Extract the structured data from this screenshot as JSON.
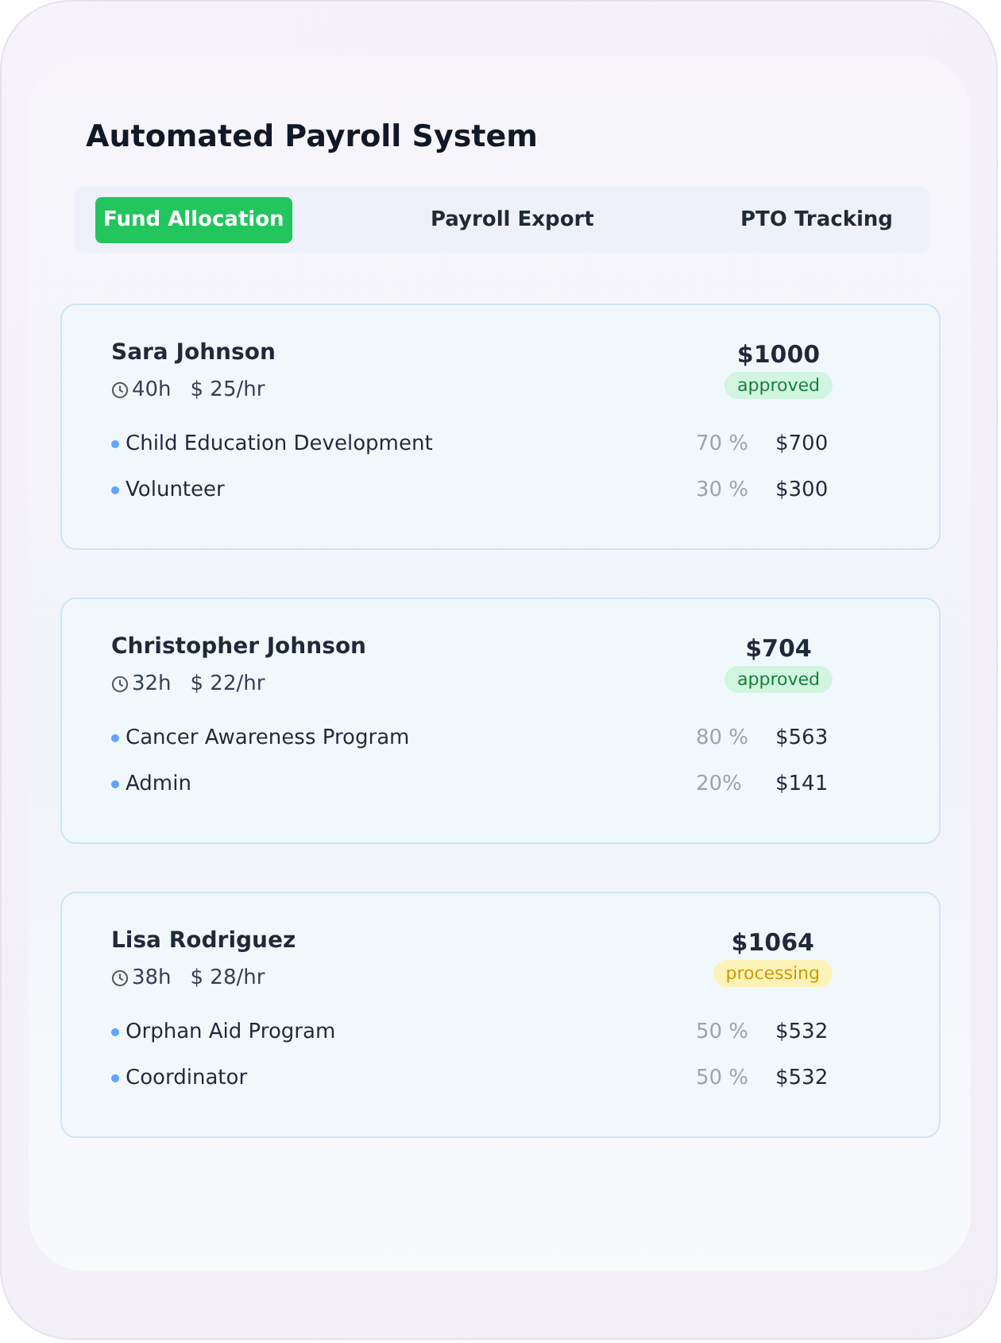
{
  "title": "Automated Payroll System",
  "tabs": [
    {
      "label": "Fund Allocation",
      "selected": true
    },
    {
      "label": "Payroll Export",
      "selected": false
    },
    {
      "label": "PTO Tracking",
      "selected": false
    }
  ],
  "employees": [
    {
      "name": "Sara Johnson",
      "hours": "40h",
      "rate": "$ 25/hr",
      "total": "$1000",
      "status": {
        "text": "approved",
        "kind": "success"
      },
      "allocations": [
        {
          "label": "Child Education Development",
          "percent": "70 %",
          "amount": "$700"
        },
        {
          "label": "Volunteer",
          "percent": "30 %",
          "amount": "$300"
        }
      ]
    },
    {
      "name": "Christopher Johnson",
      "hours": "32h",
      "rate": "$ 22/hr",
      "total": "$704",
      "status": {
        "text": "approved",
        "kind": "success"
      },
      "allocations": [
        {
          "label": "Cancer Awareness Program",
          "percent": "80 %",
          "amount": "$563"
        },
        {
          "label": "Admin",
          "percent": "20%",
          "amount": "$141"
        }
      ]
    },
    {
      "name": "Lisa Rodriguez",
      "hours": "38h",
      "rate": "$ 28/hr",
      "total": "$1064",
      "status": {
        "text": "processing",
        "kind": "warning"
      },
      "allocations": [
        {
          "label": "Orphan Aid Program",
          "percent": "50 %",
          "amount": "$532"
        },
        {
          "label": "Coordinator",
          "percent": "50 %",
          "amount": "$532"
        }
      ]
    }
  ]
}
